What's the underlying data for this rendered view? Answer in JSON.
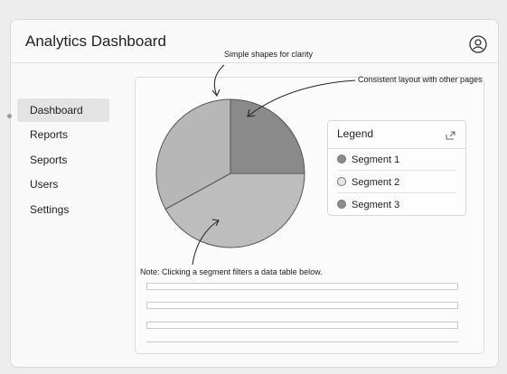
{
  "app": {
    "title": "Analytics Dashboard"
  },
  "header": {
    "user_icon": "user-circle-icon"
  },
  "sidebar": {
    "items": [
      {
        "label": "Dashboard",
        "active": true
      },
      {
        "label": "Reports",
        "active": false
      },
      {
        "label": "Seports",
        "active": false
      },
      {
        "label": "Users",
        "active": false
      },
      {
        "label": "Settings",
        "active": false
      }
    ]
  },
  "annotations": {
    "shapes": "Simple shapes for clarity",
    "layout": "Consistent layout with other pages",
    "note": "Note: Clicking a segment filters a data table below."
  },
  "legend": {
    "title": "Legend",
    "icon": "expand-icon",
    "items": [
      {
        "label": "Segment 1",
        "color": "#8a8a8a"
      },
      {
        "label": "Segment 2",
        "color": "#e6e6e6"
      },
      {
        "label": "Segment 3",
        "color": "#8c8c8c"
      }
    ]
  },
  "chart_data": {
    "type": "pie",
    "slices": [
      {
        "label": "Segment 1",
        "value": 25,
        "color": "#8a8a8a"
      },
      {
        "label": "Segment 2",
        "value": 42,
        "color": "#bdbdbd"
      },
      {
        "label": "Segment 3",
        "value": 33,
        "color": "#b7b7b7"
      }
    ]
  }
}
